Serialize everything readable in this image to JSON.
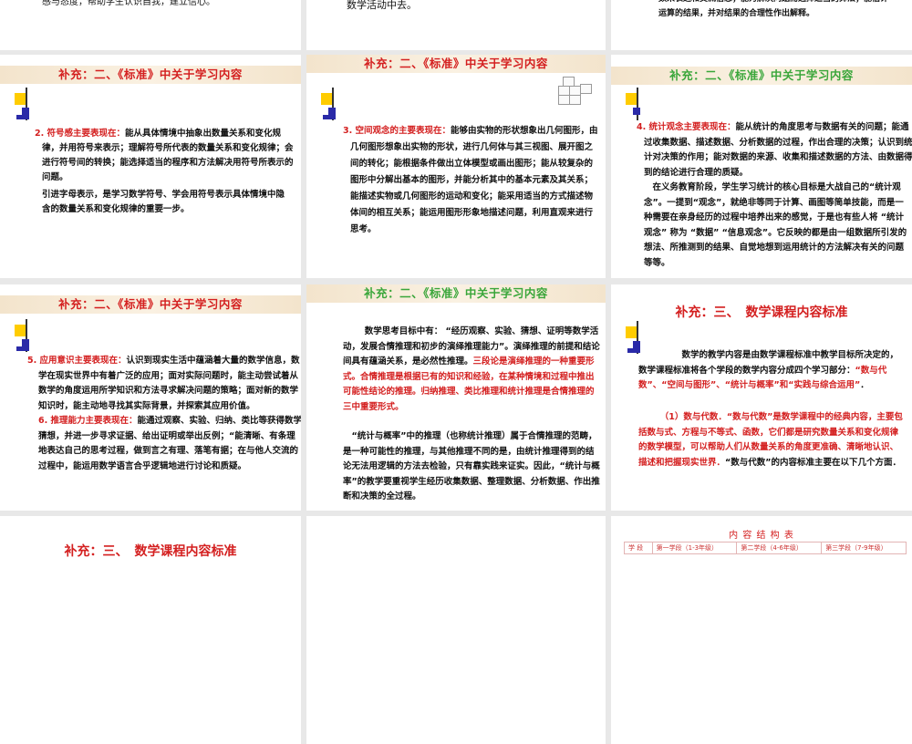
{
  "slides": {
    "s0a": {
      "text": "感与态度，帮助学生认识自我，建立信心。"
    },
    "s0b": {
      "text": "和解决问题的强有力工具，致力于改变学生的学习方式，使学生乐意并有更多的精力投入到现实的、探索性的数学活动中去。"
    },
    "s0c": {
      "text": "数来表达和交流信息；能为解决问题而选择适当的算法；能估计运算的结果，并对结果的合理性作出解释。"
    },
    "s1a": {
      "title": "补充：二、《标准》中关于学习内容",
      "lead": "2. 符号感主要表现在：",
      "body": "能从具体情境中抽象出数量关系和变化规律，并用符号来表示；理解符号所代表的数量关系和变化规律；会进行符号间的转换；能选择适当的程序和方法解决用符号所表示的问题。",
      "note": "引进字母表示，是学习数学符号、学会用符号表示具体情境中隐含的数量关系和变化规律的重要一步。"
    },
    "s1b": {
      "title": "补充：二、《标准》中关于学习内容",
      "lead": "3. 空间观念的主要表现在：",
      "body": "能够由实物的形状想象出几何图形，由几何图形想象出实物的形状，进行几何体与其三视图、展开图之间的转化；能根据条件做出立体模型或画出图形；能从较复杂的图形中分解出基本的图形，并能分析其中的基本元素及其关系；能描述实物或几何图形的运动和变化；能采用适当的方式描述物体间的相互关系；能运用图形形象地描述问题，利用直观来进行思考。"
    },
    "s1c": {
      "title": "补充：二、《标准》中关于学习内容",
      "lead": "4. 统计观念主要表现在：",
      "body": "能从统计的角度思考与数据有关的问题；能通过收集数据、描述数据、分析数据的过程，作出合理的决策；认识到统计对决策的作用；能对数据的来源、收集和描述数据的方法、由数据得到的结论进行合理的质疑。",
      "note": "在义务教育阶段，学生学习统计的核心目标是大战自己的“统计观念”。一提到“观念”，就绝非等同于计算、画图等简单技能，而是一种需要在亲身经历的过程中培养出来的感觉，于是也有些人将 “统计观念” 称为 “数据” “信息观念”。它反映的都是由一组数据所引发的想法、所推测到的结果、自觉地想到运用统计的方法解决有关的问题等等。"
    },
    "s2a": {
      "title": "补充：二、《标准》中关于学习内容",
      "lead1": "5. 应用意识主要表现在：",
      "body1": "认识到现实生活中蕴涵着大量的数学信息，数学在现实世界中有着广泛的应用；面对实际问题时，能主动尝试着从数学的角度运用所学知识和方法寻求解决问题的策略；面对新的数学知识时，能主动地寻找其实际背景，并探索其应用价值。",
      "lead2": "6. 推理能力主要表现在：",
      "body2": "能通过观察、实验、归纳、类比等获得数学猜想，并进一步寻求证据、给出证明或举出反例；“能清晰、有条理地表达自己的思考过程，做到言之有理、落笔有据；在与他人交流的过程中，能运用数学语言合乎逻辑地进行讨论和质疑。"
    },
    "s2b": {
      "title": "补充：二、《标准》中关于学习内容",
      "p1": "数学思考目标中有： “经历观察、实验、猜想、证明等数学活动，发展合情推理和初步的演绎推理能力”。演绎推理的前提和结论间具有蕴涵关系，是必然性推理。",
      "p1red": "三段论是演绎推理的一种重要形式。合情推理是根据已有的知识和经验，在某种情境和过程中推出可能性结论的推理。归纳推理、类比推理和统计推理是合情推理的三中重要形式。",
      "p2": "“统计与概率”中的推理（也称统计推理）属于合情推理的范畴，是一种可能性的推理，与其他推理不同的是，由统计推理得到的结论无法用逻辑的方法去检验，只有靠实践来证实。因此，“统计与概率”的教学要重视学生经历收集数据、整理数据、分析数据、作出推断和决策的全过程。"
    },
    "s2c": {
      "title": "补充：三、　数学课程内容标准",
      "p1": "数学的教学内容是由数学课程标准中教学目标所决定的，数学课程标准将各个学段的数学内容分成四个学习部分：",
      "p1red": "“数与代数”、“空间与图形”、“统计与概率”和“实践与综合运用”",
      "p1end": "．",
      "p2red": "（1）数与代数．“数与代数”是数学课程中的经典内容，主要包括数与式、方程与不等式、函数，它们都是研究数量关系和变化规律的数学模型，可以帮助人们从数量关系的角度更准确、清晰地认识、描述和把握现实世界．",
      "p2": "“数与代数”的内容标准主要在以下几个方面．"
    },
    "s3a": {
      "title": "补充：三、　数学课程内容标准"
    },
    "s3c": {
      "title": "内 容 结 构 表",
      "headers": [
        "学 段",
        "第一学段（1-3年级）",
        "第二学段（4-6年级）",
        "第三学段（7-9年级）"
      ]
    }
  },
  "colors": {
    "red": "#d42020",
    "green": "#3aa63a",
    "blue": "#2626c0",
    "banner": "#f3e4cc"
  }
}
